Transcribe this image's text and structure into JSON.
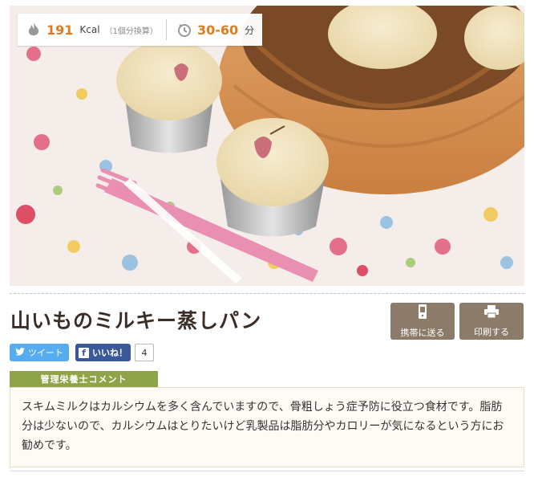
{
  "recipe": {
    "title": "山いものミルキー蒸しパン",
    "photo_alt": "山いものミルキー蒸しパン"
  },
  "nutrition": {
    "kcal_value": "191",
    "kcal_unit": "Kcal",
    "kcal_note": "（1個分換算）",
    "time_value": "30-60",
    "time_unit": "分",
    "accent_color": "#e07b20"
  },
  "actions": {
    "mobile_label": "携帯に送る",
    "print_label": "印刷する"
  },
  "share": {
    "tweet_label": "ツイート",
    "like_label": "いいね！",
    "like_count": "4"
  },
  "comment": {
    "heading": "管理栄養士コメント",
    "body": "スキムミルクはカルシウムを多く含んでいますので、骨粗しょう症予防に役立つ食材です。脂肪分は少ないので、カルシウムはとりたいけど乳製品は脂肪分やカロリーが気になるという方にお勧めです。"
  }
}
